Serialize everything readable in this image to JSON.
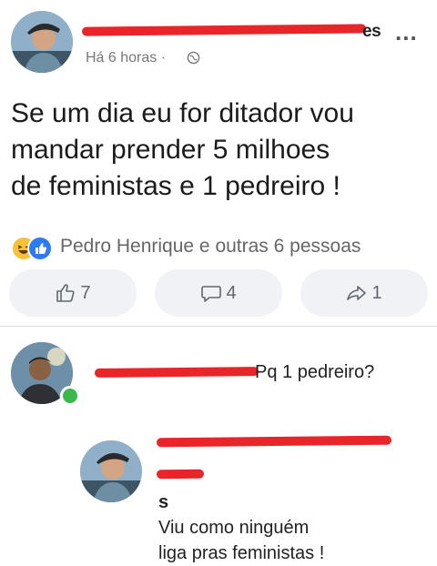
{
  "post": {
    "author_name_tail": "es",
    "more_label": "...",
    "timestamp": "Há 6 horas",
    "separator": "·",
    "privacy_icon": "globe-icon",
    "body_lines": [
      "Se um dia eu for ditador vou",
      "mandar prender 5 milhoes",
      "de feministas e 1 pedreiro !"
    ]
  },
  "reactions": {
    "icons": [
      "haha-icon",
      "like-icon"
    ],
    "summary": "Pedro Henrique e outras 6 pessoas"
  },
  "actions": {
    "like_count": "7",
    "comment_count": "4",
    "share_count": "1"
  },
  "comments": [
    {
      "text": "Pq 1 pedreiro?"
    },
    {
      "name_tail": "s",
      "lines": [
        "Viu como ninguém",
        "liga pras feministas !"
      ]
    }
  ],
  "colors": {
    "redaction": "#e8262a",
    "online": "#3bb84c",
    "like": "#2d7bf1"
  }
}
